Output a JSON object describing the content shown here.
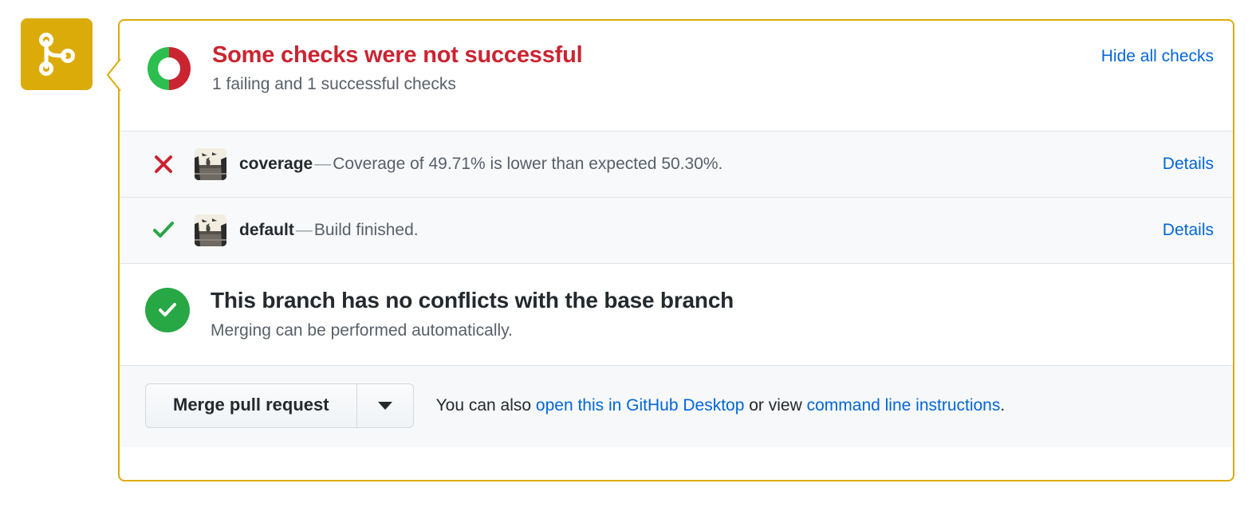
{
  "branch_badge": {
    "icon": "git-merge-icon",
    "background_color": "#dbab09"
  },
  "card": {
    "border_color": "#dbab09"
  },
  "header": {
    "status_icon": "donut-status-icon",
    "title": "Some checks were not successful",
    "title_color": "#cb2431",
    "subtitle": "1 failing and 1 successful checks",
    "toggle_label": "Hide all checks",
    "link_color": "#0366d6"
  },
  "checks": [
    {
      "status": "failure",
      "status_icon": "x-icon",
      "status_color": "#cb2431",
      "avatar": "check-avatar-image",
      "name": "coverage",
      "dash": "—",
      "description": "Coverage of 49.71% is lower than expected 50.30%.",
      "details_label": "Details"
    },
    {
      "status": "success",
      "status_icon": "check-icon",
      "status_color": "#28a745",
      "avatar": "check-avatar-image",
      "name": "default",
      "dash": "—",
      "description": "Build finished.",
      "details_label": "Details"
    }
  ],
  "conflict": {
    "icon": "check-circle-filled-icon",
    "icon_color": "#28a745",
    "title": "This branch has no conflicts with the base branch",
    "subtitle": "Merging can be performed automatically."
  },
  "footer": {
    "merge_button_label": "Merge pull request",
    "dropdown_icon": "chevron-down-icon",
    "note_prefix": "You can also ",
    "desktop_link": "open this in GitHub Desktop",
    "note_middle": " or view ",
    "cli_link": "command line instructions",
    "note_suffix": "."
  }
}
